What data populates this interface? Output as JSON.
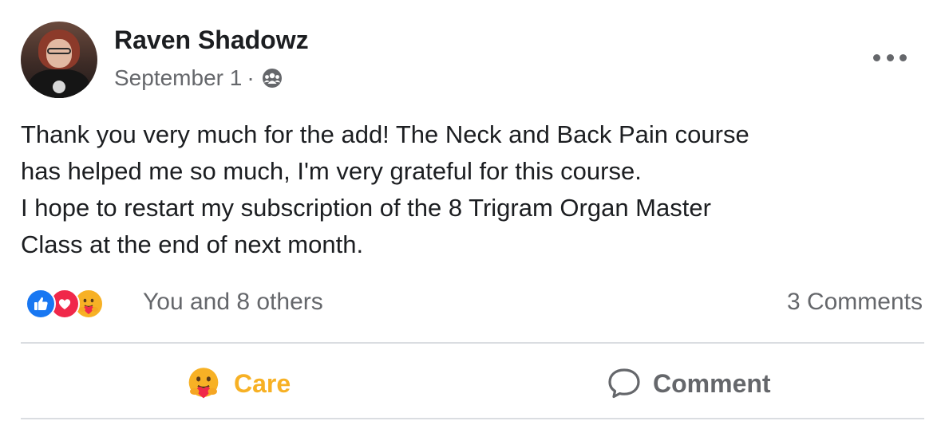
{
  "post": {
    "author": "Raven Shadowz",
    "date": "September 1",
    "separator": "·",
    "audience_icon": "group-icon",
    "more_icon": "more-options-icon",
    "body": [
      "Thank you very much for the add!  The Neck and Back Pain course",
      "has helped me so much, I'm very grateful for this course.",
      "I hope to restart my subscription of the 8 Trigram Organ Master",
      "Class at the end of next month."
    ]
  },
  "reactions": {
    "icons": [
      "like-icon",
      "love-icon",
      "care-icon"
    ],
    "summary": "You and 8 others",
    "comments": "3 Comments"
  },
  "actions": {
    "care_label": "Care",
    "comment_label": "Comment"
  },
  "colors": {
    "like": "#1877f2",
    "love": "#f0284a",
    "care": "#f7b125",
    "secondary_text": "#65676b",
    "divider": "#dadde1"
  }
}
